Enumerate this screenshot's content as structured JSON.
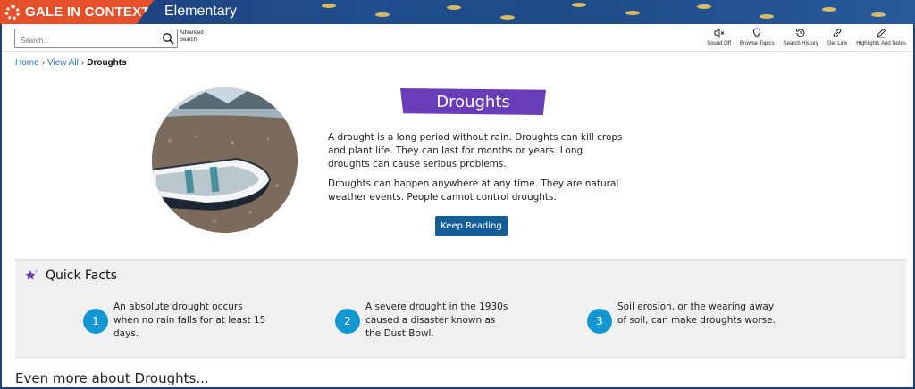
{
  "header": {
    "brand": "GALE IN CONTEXT",
    "edition": "Elementary",
    "brand_color": "#e4502a"
  },
  "search": {
    "placeholder": "Search...",
    "advanced_line1": "Advanced",
    "advanced_line2": "Search"
  },
  "tools": [
    {
      "label": "Sound Off",
      "icon": "speaker-mute-icon"
    },
    {
      "label": "Browse Topics",
      "icon": "lightbulb-icon"
    },
    {
      "label": "Search History",
      "icon": "history-icon"
    },
    {
      "label": "Get Link",
      "icon": "link-icon"
    },
    {
      "label": "Highlights And Notes",
      "icon": "pencil-icon"
    }
  ],
  "breadcrumb": {
    "home": "Home",
    "view_all": "View All",
    "current": "Droughts",
    "separator": "›"
  },
  "topic": {
    "title": "Droughts",
    "title_color": "#6a3db8",
    "paragraph1": "A drought is a long period without rain. Droughts can kill crops and plant life. They can last for months or years. Long droughts can cause serious problems.",
    "paragraph2": "Droughts can happen anywhere at any time. They are natural weather events. People cannot control droughts.",
    "keep_reading": "Keep Reading"
  },
  "quick_facts": {
    "heading": "Quick Facts",
    "items": [
      {
        "number": "1",
        "text": "An absolute drought occurs when no rain falls for at least 15 days."
      },
      {
        "number": "2",
        "text": "A severe drought in the 1930s caused a disaster known as the Dust Bowl."
      },
      {
        "number": "3",
        "text": "Soil erosion, or the wearing away of soil, can make droughts worse."
      }
    ]
  },
  "more_heading": "Even more about Droughts..."
}
